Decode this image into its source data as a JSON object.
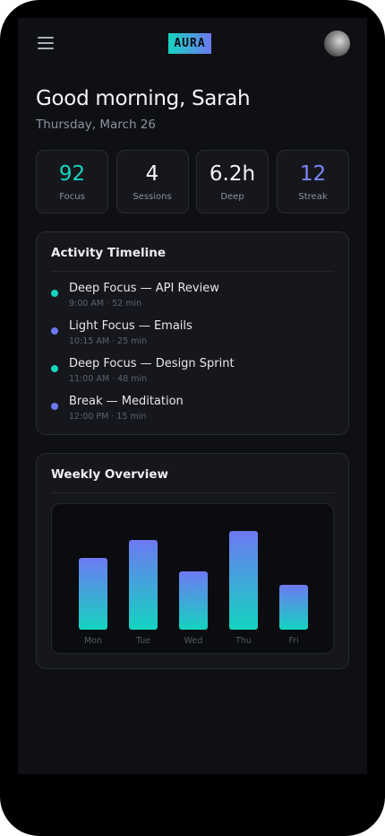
{
  "header": {
    "logo_text": "AURA",
    "menu_icon": "hamburger-menu-icon",
    "avatar_icon": "user-avatar"
  },
  "greeting": {
    "title": "Good morning, Sarah",
    "date": "Thursday, March 26"
  },
  "stats": [
    {
      "value": "92",
      "label": "Focus",
      "color": "#14d4c0"
    },
    {
      "value": "4",
      "label": "Sessions",
      "color": "#f3f4f7"
    },
    {
      "value": "6.2h",
      "label": "Deep",
      "color": "#f3f4f7"
    },
    {
      "value": "12",
      "label": "Streak",
      "color": "#7b86ff"
    }
  ],
  "timeline": {
    "title": "Activity Timeline",
    "items": [
      {
        "title": "Deep Focus — API Review",
        "meta": "9:00 AM · 52 min",
        "dot_color": "#14d4c0"
      },
      {
        "title": "Light Focus — Emails",
        "meta": "10:15 AM · 25 min",
        "dot_color": "#6d79f2"
      },
      {
        "title": "Deep Focus — Design Sprint",
        "meta": "11:00 AM · 48 min",
        "dot_color": "#14d4c0"
      },
      {
        "title": "Break — Meditation",
        "meta": "12:00 PM · 15 min",
        "dot_color": "#6d79f2"
      }
    ]
  },
  "weekly": {
    "title": "Weekly Overview"
  },
  "chart_data": {
    "type": "bar",
    "categories": [
      "Mon",
      "Tue",
      "Wed",
      "Thu",
      "Fri"
    ],
    "values": [
      80,
      100,
      65,
      110,
      50
    ],
    "title": "Weekly Overview",
    "xlabel": "",
    "ylabel": "",
    "ylim": [
      0,
      125
    ],
    "grid": false,
    "colors": {
      "top": "#6d79f2",
      "bottom": "#14d4c0"
    }
  }
}
